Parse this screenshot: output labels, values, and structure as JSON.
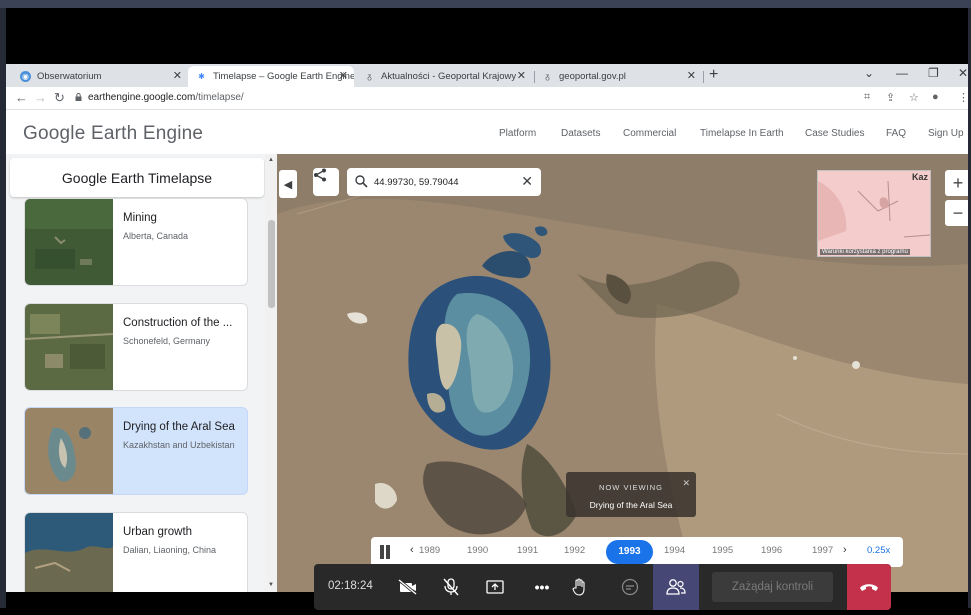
{
  "browser": {
    "tabs": [
      {
        "label": "Obserwatorium",
        "active": false
      },
      {
        "label": "Timelapse – Google Earth Engine",
        "active": true
      },
      {
        "label": "Aktualności - Geoportal Krajowy",
        "active": false
      },
      {
        "label": "geoportal.gov.pl",
        "active": false
      }
    ],
    "url_host": "earthengine.google.com",
    "url_path": "/timelapse/"
  },
  "header": {
    "logo": "Google Earth Engine",
    "nav": [
      "Platform",
      "Datasets",
      "Commercial",
      "Timelapse In Earth",
      "Case Studies",
      "FAQ",
      "Sign Up"
    ]
  },
  "sidebar": {
    "title": "Google Earth Timelapse",
    "stories": [
      {
        "title": "Mining",
        "subtitle": "Alberta, Canada",
        "selected": false
      },
      {
        "title": "Construction of the ...",
        "subtitle": "Schonefeld, Germany",
        "selected": false
      },
      {
        "title": "Drying of the Aral Sea",
        "subtitle": "Kazakhstan and Uzbekistan",
        "selected": true
      },
      {
        "title": "Urban growth",
        "subtitle": "Dalian, Liaoning, China",
        "selected": false
      }
    ]
  },
  "map": {
    "search_value": "44.99730, 59.79044",
    "minimap_label": "Kaz",
    "minimap_terms": "Warunki korzystania z programu",
    "now_viewing_label": "NOW VIEWING",
    "now_viewing_title": "Drying of the Aral Sea"
  },
  "timeline": {
    "years": [
      "1989",
      "1990",
      "1991",
      "1992",
      "1993",
      "1994",
      "1995",
      "1996",
      "1997"
    ],
    "current_year": "1993",
    "speed": "0.25x"
  },
  "call": {
    "elapsed": "02:18:24",
    "request_control": "Zażądaj kontroli"
  },
  "colors": {
    "accent": "#1a73e8",
    "selected_story": "#d2e3fc",
    "participants": "#464775",
    "hangup": "#c4314b"
  }
}
